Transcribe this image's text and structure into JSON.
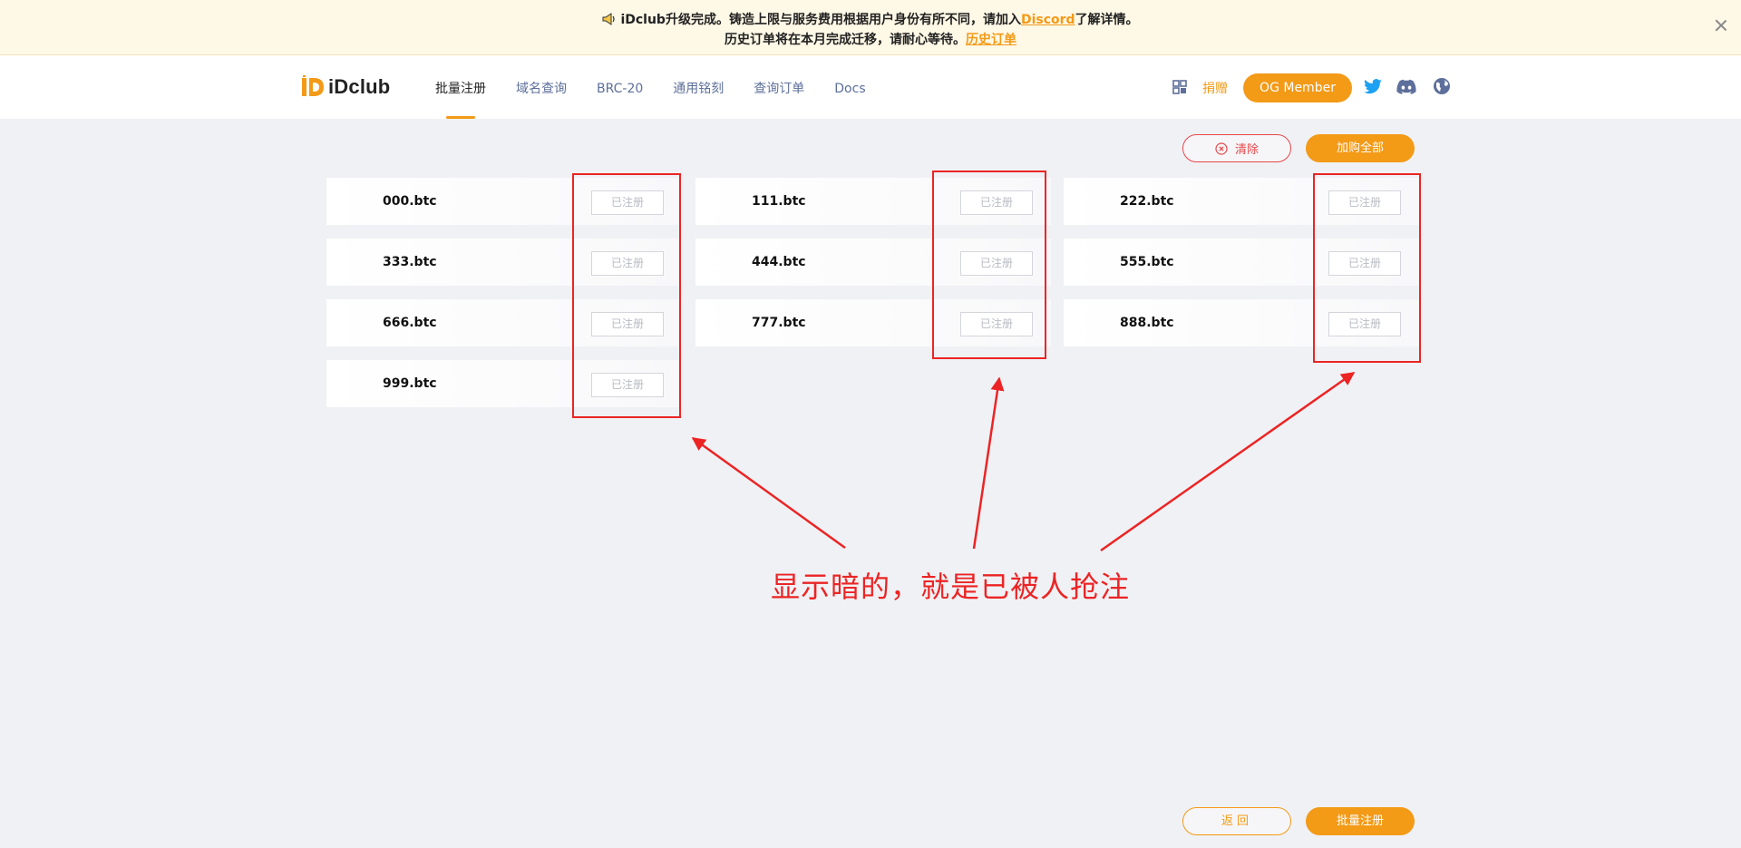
{
  "announcement": {
    "line1_prefix": "iDclub升级完成。铸造上限与服务费用根据用户身份有所不同，请加入",
    "line1_link": "Discord",
    "line1_suffix": "了解详情。",
    "line2_prefix": "历史订单将在本月完成迁移，请耐心等待。",
    "line2_link": "历史订单"
  },
  "header": {
    "logo_text": "iDclub",
    "nav": [
      {
        "label": "批量注册",
        "active": true
      },
      {
        "label": "域名查询",
        "active": false
      },
      {
        "label": "BRC-20",
        "active": false
      },
      {
        "label": "通用铭刻",
        "active": false
      },
      {
        "label": "查询订单",
        "active": false
      },
      {
        "label": "Docs",
        "active": false
      }
    ],
    "donate": "捐赠",
    "og_member": "OG Member"
  },
  "toolbar": {
    "clear": "清除",
    "add_all": "加购全部"
  },
  "domains": [
    {
      "name": "000.btc",
      "status": "已注册"
    },
    {
      "name": "111.btc",
      "status": "已注册"
    },
    {
      "name": "222.btc",
      "status": "已注册"
    },
    {
      "name": "333.btc",
      "status": "已注册"
    },
    {
      "name": "444.btc",
      "status": "已注册"
    },
    {
      "name": "555.btc",
      "status": "已注册"
    },
    {
      "name": "666.btc",
      "status": "已注册"
    },
    {
      "name": "777.btc",
      "status": "已注册"
    },
    {
      "name": "888.btc",
      "status": "已注册"
    },
    {
      "name": "999.btc",
      "status": "已注册"
    }
  ],
  "footer": {
    "back": "返回",
    "batch_register": "批量注册"
  },
  "annotation": {
    "text": "显示暗的，就是已被人抢注"
  },
  "colors": {
    "accent": "#f39a17",
    "annotation_red": "#ec2424",
    "page_bg": "#f0f1f5",
    "notice_bg": "#fef8e6"
  }
}
